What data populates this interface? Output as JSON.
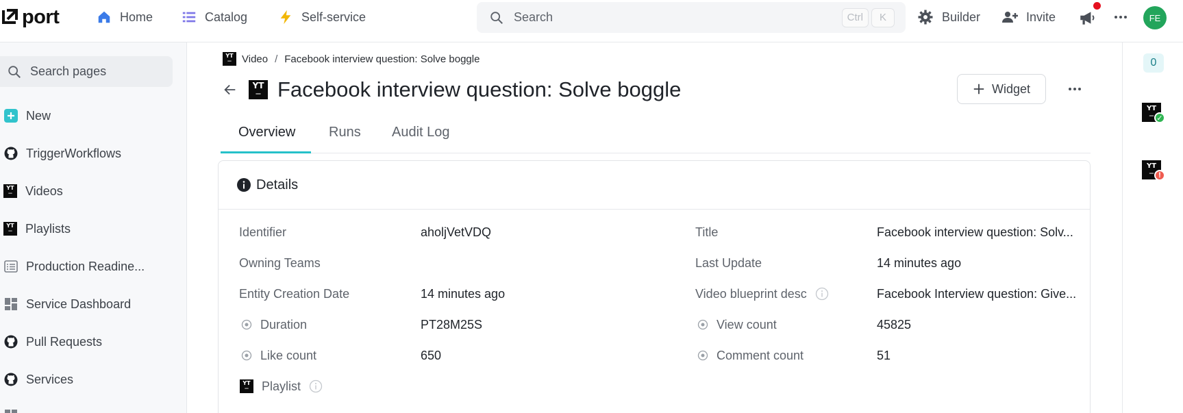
{
  "header": {
    "logo_text": "port",
    "nav": [
      {
        "label": "Home",
        "icon": "home-icon"
      },
      {
        "label": "Catalog",
        "icon": "list-icon"
      },
      {
        "label": "Self-service",
        "icon": "lightning-icon"
      }
    ],
    "search": {
      "placeholder": "Search",
      "shortcut_1": "Ctrl",
      "shortcut_2": "K"
    },
    "builder_label": "Builder",
    "invite_label": "Invite",
    "avatar_initials": "FE"
  },
  "sidebar": {
    "search_placeholder": "Search pages",
    "items": [
      {
        "label": "New",
        "icon": "plus-square-icon"
      },
      {
        "label": "TriggerWorkflows",
        "icon": "github-icon"
      },
      {
        "label": "Videos",
        "icon": "youtube-icon"
      },
      {
        "label": "Playlists",
        "icon": "youtube-icon"
      },
      {
        "label": "Production Readine...",
        "icon": "scorecard-icon"
      },
      {
        "label": "Service Dashboard",
        "icon": "dashboard-icon"
      },
      {
        "label": "Pull Requests",
        "icon": "github-icon"
      },
      {
        "label": "Services",
        "icon": "github-icon"
      }
    ]
  },
  "breadcrumb": {
    "parent": "Video",
    "separator": "/",
    "current": "Facebook interview question: Solve boggle"
  },
  "page": {
    "title": "Facebook interview question: Solve boggle",
    "widget_label": "Widget",
    "yt_label": "YT"
  },
  "tabs": [
    {
      "label": "Overview"
    },
    {
      "label": "Runs"
    },
    {
      "label": "Audit Log"
    }
  ],
  "details": {
    "header": "Details",
    "left": [
      {
        "label": "Identifier",
        "value": "aholjVetVDQ"
      },
      {
        "label": "Owning Teams",
        "value": ""
      },
      {
        "label": "Entity Creation Date",
        "value": "14 minutes ago"
      },
      {
        "label": "Duration",
        "value": "PT28M25S"
      },
      {
        "label": "Like count",
        "value": "650"
      },
      {
        "label": "Playlist",
        "value": ""
      }
    ],
    "right": [
      {
        "label": "Title",
        "value": "Facebook interview question: Solv..."
      },
      {
        "label": "Last Update",
        "value": "14 minutes ago"
      },
      {
        "label": "Video blueprint desc",
        "value": "Facebook Interview question: Give..."
      },
      {
        "label": "View count",
        "value": "45825"
      },
      {
        "label": "Comment count",
        "value": "51"
      }
    ]
  },
  "rail": {
    "count": "0"
  },
  "colors": {
    "accent": "#25c1c9",
    "avatar": "#22a55b",
    "success": "#2fb552",
    "error": "#ef5b4f",
    "notification": "#e5101f"
  }
}
